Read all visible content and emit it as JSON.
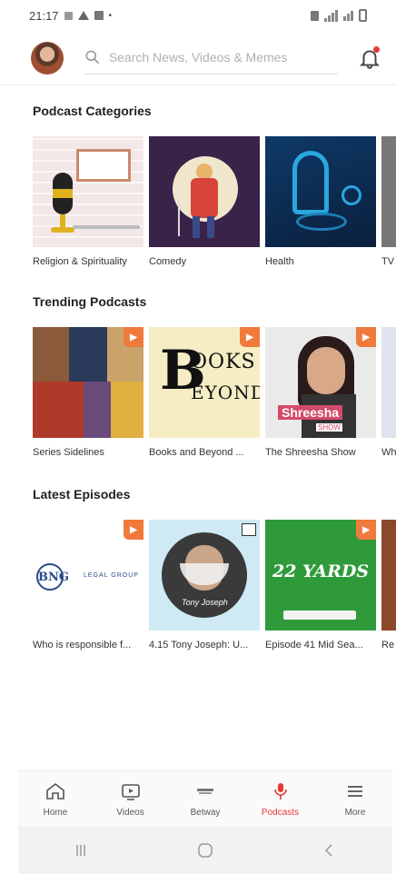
{
  "status": {
    "time": "21:17"
  },
  "header": {
    "search_placeholder": "Search News, Videos & Memes"
  },
  "sections": {
    "categories": {
      "title": "Podcast Categories",
      "items": [
        {
          "label": "Religion & Spirituality"
        },
        {
          "label": "Comedy"
        },
        {
          "label": "Health"
        },
        {
          "label": "TV"
        }
      ]
    },
    "trending": {
      "title": "Trending Podcasts",
      "items": [
        {
          "label": "Series Sidelines"
        },
        {
          "label": "Books and Beyond ..."
        },
        {
          "label": "The Shreesha Show"
        },
        {
          "label": "Wh"
        }
      ]
    },
    "latest": {
      "title": "Latest Episodes",
      "items": [
        {
          "label": "Who is responsible f..."
        },
        {
          "label": "4.15 Tony Joseph: U..."
        },
        {
          "label": "Episode 41 Mid Sea..."
        },
        {
          "label": "Re"
        }
      ]
    }
  },
  "thumb_text": {
    "books_line1": "OOKS",
    "books_line2": "EYOND",
    "books_big": "B",
    "shreesha": "Shreesha",
    "shreesha_sub": "SHOW",
    "yards": "22 YARDS",
    "tony": "Tony Joseph",
    "bng": "BNG",
    "bng_sub": "LEGAL GROUP"
  },
  "nav": {
    "items": [
      {
        "label": "Home",
        "icon": "home-icon"
      },
      {
        "label": "Videos",
        "icon": "video-icon"
      },
      {
        "label": "Betway",
        "icon": "betway-icon"
      },
      {
        "label": "Podcasts",
        "icon": "podcast-icon",
        "active": true
      },
      {
        "label": "More",
        "icon": "menu-icon"
      }
    ]
  },
  "colors": {
    "accent": "#e53935",
    "badge": "#f07a3c"
  }
}
